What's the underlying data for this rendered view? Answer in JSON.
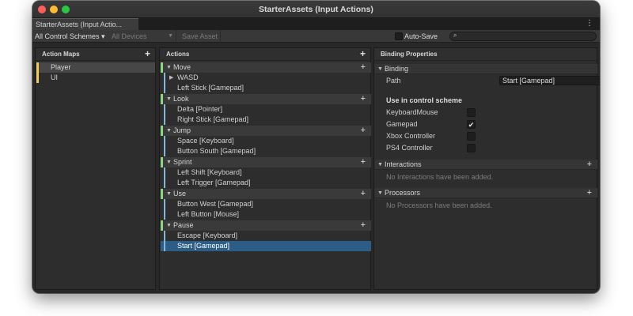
{
  "window": {
    "title": "StarterAssets (Input Actions)"
  },
  "tab": {
    "label": "StarterAssets (Input Actio..."
  },
  "toolbar": {
    "control_schemes": "All Control Schemes ▾",
    "devices": "All Devices",
    "save_asset": "Save Asset",
    "auto_save": "Auto-Save",
    "search_value": ""
  },
  "action_maps": {
    "header": "Action Maps",
    "items": [
      {
        "label": "Player",
        "selected": true
      },
      {
        "label": "UI",
        "selected": false
      }
    ]
  },
  "actions": {
    "header": "Actions",
    "items": [
      {
        "label": "Move"
      },
      {
        "label": "WASD"
      },
      {
        "label": "Left Stick [Gamepad]"
      },
      {
        "label": "Look"
      },
      {
        "label": "Delta [Pointer]"
      },
      {
        "label": "Right Stick [Gamepad]"
      },
      {
        "label": "Jump"
      },
      {
        "label": "Space [Keyboard]"
      },
      {
        "label": "Button South [Gamepad]"
      },
      {
        "label": "Sprint"
      },
      {
        "label": "Left Shift [Keyboard]"
      },
      {
        "label": "Left Trigger [Gamepad]"
      },
      {
        "label": "Use"
      },
      {
        "label": "Button West [Gamepad]"
      },
      {
        "label": "Left Button [Mouse]"
      },
      {
        "label": "Pause"
      },
      {
        "label": "Escape [Keyboard]"
      },
      {
        "label": "Start [Gamepad]"
      }
    ]
  },
  "binding_properties": {
    "header": "Binding Properties",
    "binding_section": "Binding",
    "path_label": "Path",
    "path_value": "Start [Gamepad]",
    "t_button": "T",
    "control_scheme_heading": "Use in control scheme",
    "schemes": [
      {
        "label": "KeyboardMouse",
        "checked": false
      },
      {
        "label": "Gamepad",
        "checked": true
      },
      {
        "label": "Xbox Controller",
        "checked": false
      },
      {
        "label": "PS4 Controller",
        "checked": false
      }
    ],
    "interactions_section": "Interactions",
    "interactions_empty": "No Interactions have been added.",
    "processors_section": "Processors",
    "processors_empty": "No Processors have been added."
  },
  "glyphs": {
    "plus": "+",
    "kebab": "⋮",
    "check": "✔",
    "caret_down": "▼",
    "caret_right": "▶",
    "search": "⌕"
  },
  "colors": {
    "window_bg": "#282828",
    "action_map_marker": "#f6ca59",
    "action_marker": "#8fd57c",
    "binding_marker": "#7fb8d6",
    "selection": "#2c5d87"
  }
}
